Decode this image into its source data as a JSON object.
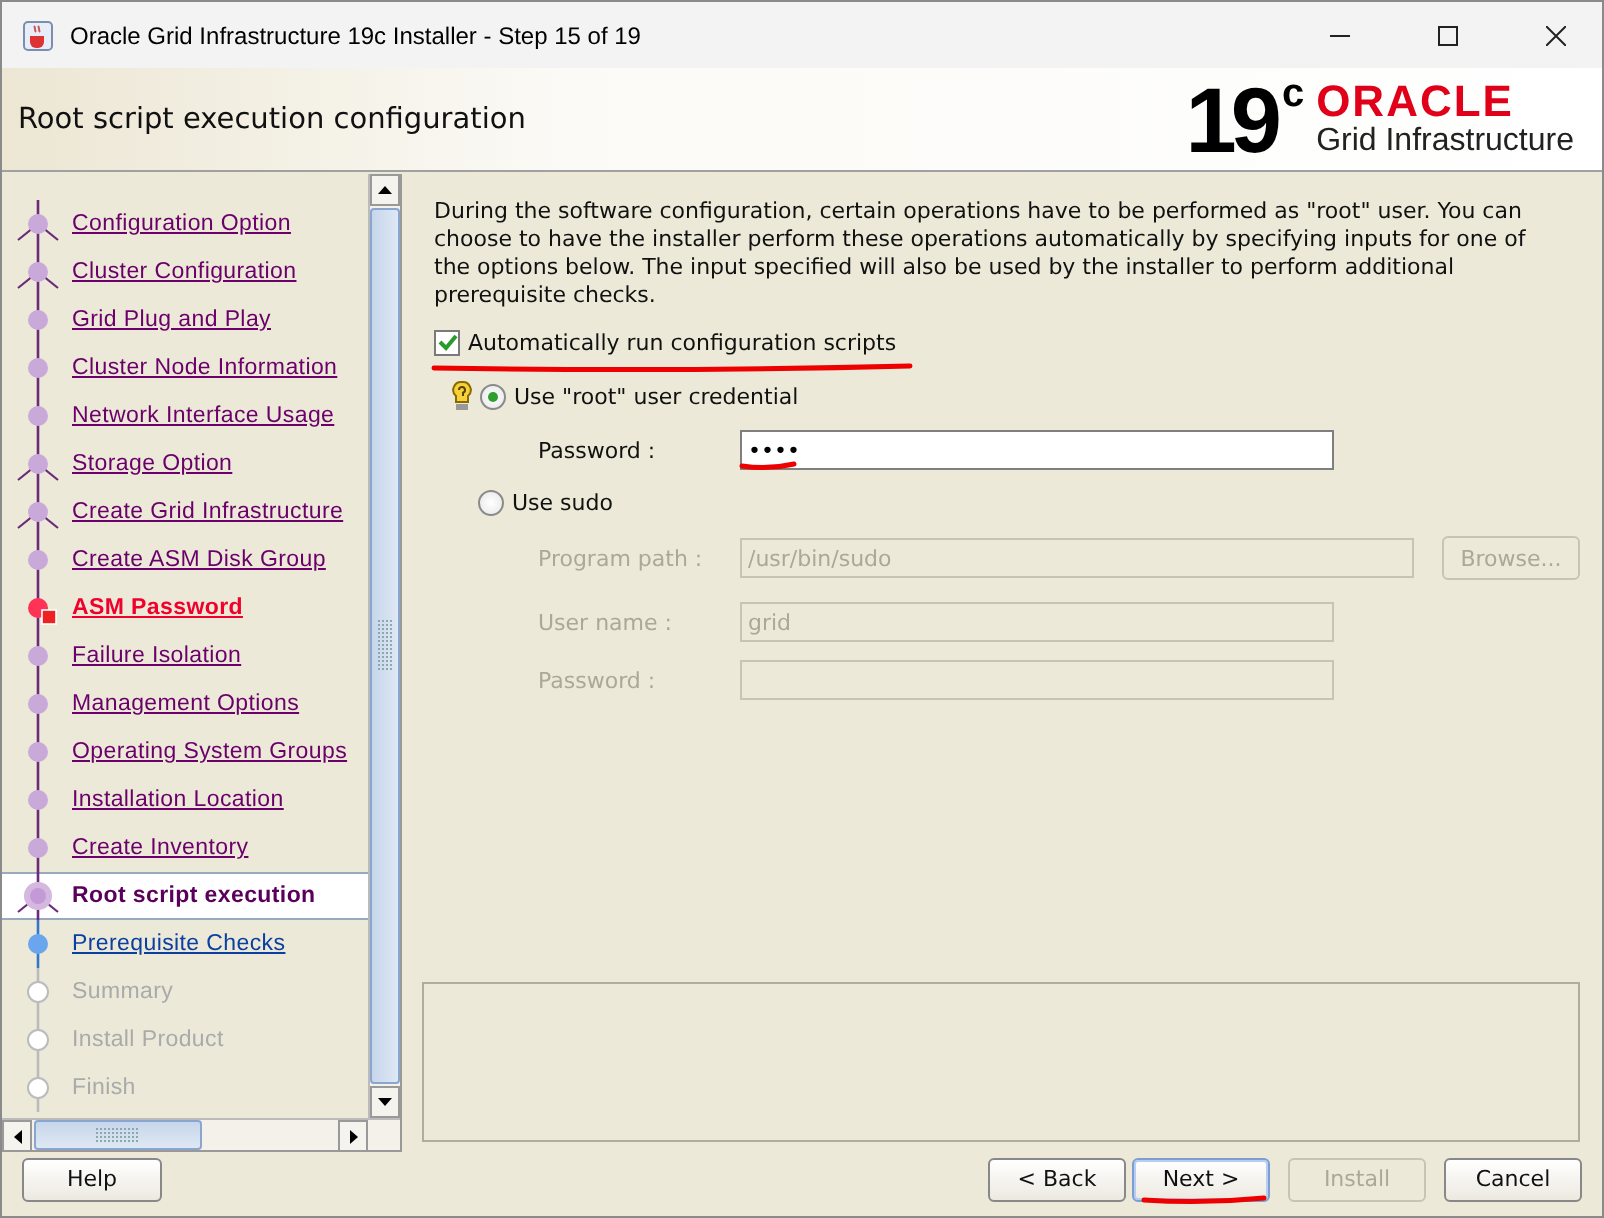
{
  "window": {
    "title": "Oracle Grid Infrastructure 19c Installer - Step 15 of 19"
  },
  "header": {
    "title": "Root script execution configuration",
    "logo_version": "19",
    "logo_sup": "c",
    "logo_brand": "ORACLE",
    "logo_product": "Grid Infrastructure"
  },
  "steps": [
    {
      "label": "Configuration Option",
      "kind": "done",
      "branch": true
    },
    {
      "label": "Cluster Configuration",
      "kind": "done",
      "branch": true
    },
    {
      "label": "Grid Plug and Play",
      "kind": "done",
      "branch": false
    },
    {
      "label": "Cluster Node Information",
      "kind": "done",
      "branch": false
    },
    {
      "label": "Network Interface Usage",
      "kind": "done",
      "branch": false
    },
    {
      "label": "Storage Option",
      "kind": "done",
      "branch": true
    },
    {
      "label": "Create Grid Infrastructure",
      "kind": "done",
      "branch": true
    },
    {
      "label": "Create ASM Disk Group",
      "kind": "done",
      "branch": false
    },
    {
      "label": "ASM Password",
      "kind": "error",
      "branch": false
    },
    {
      "label": "Failure Isolation",
      "kind": "done",
      "branch": false
    },
    {
      "label": "Management Options",
      "kind": "done",
      "branch": false
    },
    {
      "label": "Operating System Groups",
      "kind": "done",
      "branch": false
    },
    {
      "label": "Installation Location",
      "kind": "done",
      "branch": false
    },
    {
      "label": "Create Inventory",
      "kind": "done",
      "branch": false
    },
    {
      "label": "Root script execution",
      "kind": "current",
      "branch": true
    },
    {
      "label": "Prerequisite Checks",
      "kind": "next",
      "branch": false
    },
    {
      "label": "Summary",
      "kind": "pending",
      "branch": false
    },
    {
      "label": "Install Product",
      "kind": "pending",
      "branch": false
    },
    {
      "label": "Finish",
      "kind": "pending",
      "branch": false
    }
  ],
  "description": "During the software configuration, certain operations have to be performed as \"root\" user. You can choose to have the installer perform these operations automatically by specifying inputs for one of the options below. The input specified will also be used by the installer to perform additional prerequisite checks.",
  "auto_run": {
    "label": "Automatically run configuration scripts",
    "checked": true,
    "annotated": true
  },
  "root_option": {
    "label": "Use \"root\" user credential",
    "selected": true,
    "password_label": "Password :",
    "password_value": "••••",
    "annotated": true
  },
  "sudo_option": {
    "label": "Use sudo",
    "selected": false,
    "program_path_label": "Program path :",
    "program_path_value": "/usr/bin/sudo",
    "browse": "Browse...",
    "user_name_label": "User name :",
    "user_name_value": "grid",
    "password_label": "Password :"
  },
  "buttons": {
    "help": "Help",
    "back": "< Back",
    "next": "Next >",
    "install": "Install",
    "install_disabled": true,
    "cancel": "Cancel",
    "next_annotated": true
  }
}
